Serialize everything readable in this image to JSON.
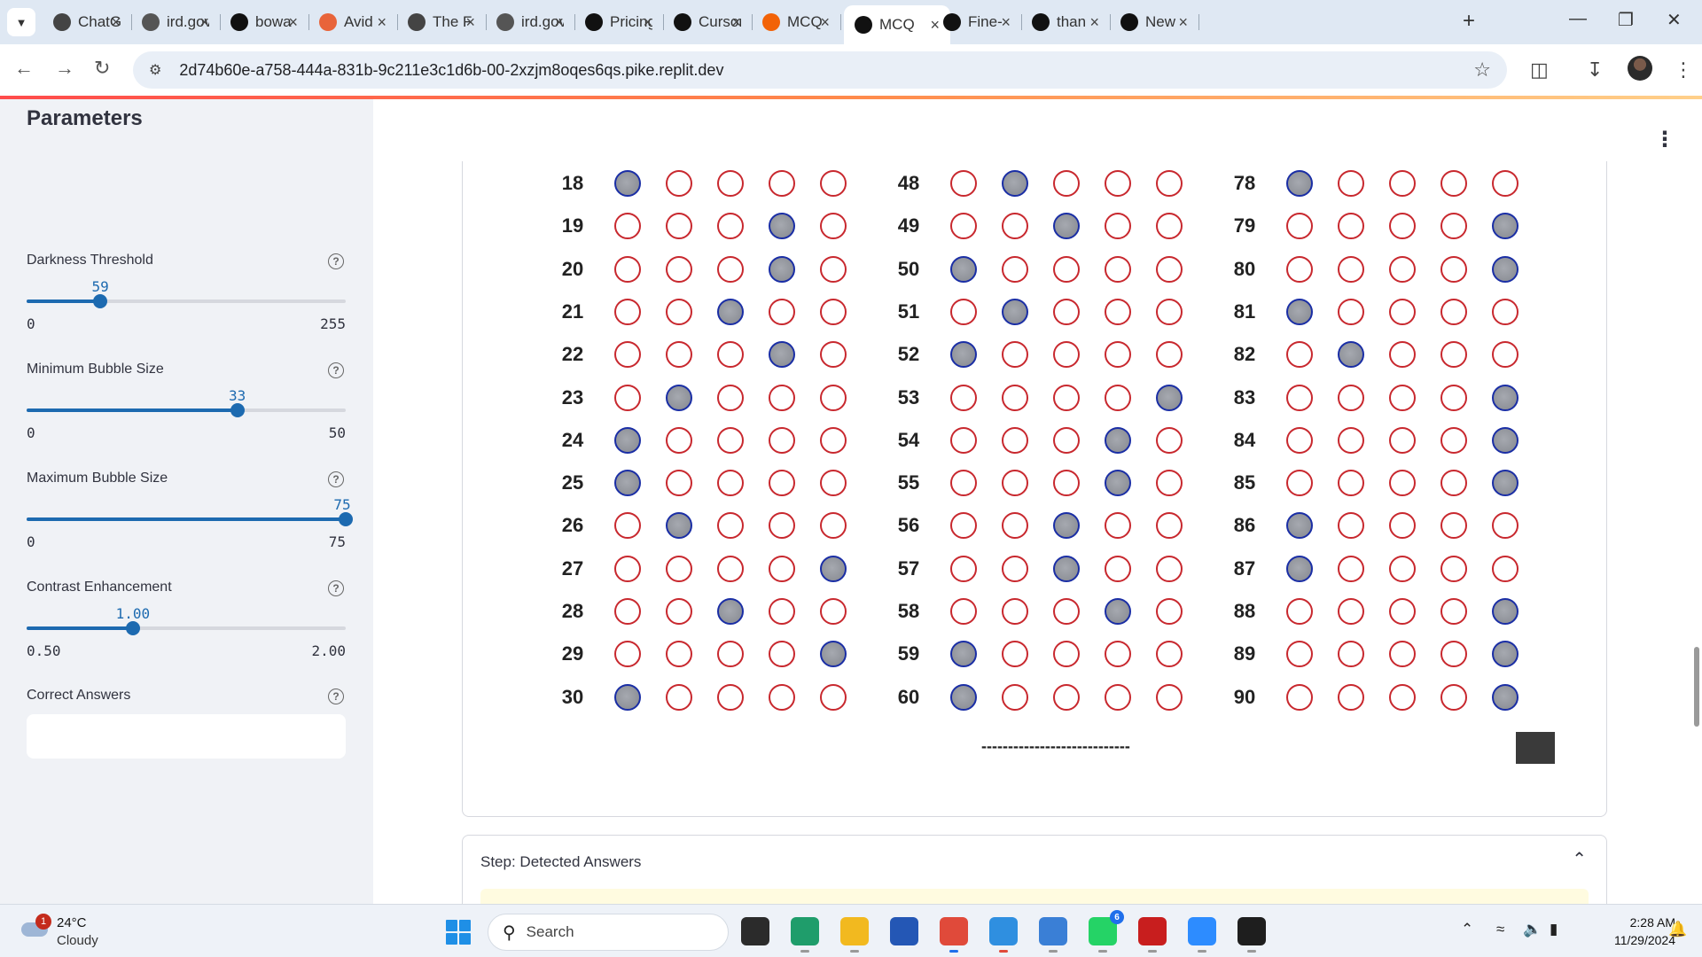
{
  "browser": {
    "tabs": [
      {
        "label": "ChatGPT",
        "icon": "chatgpt-icon",
        "color": "#444"
      },
      {
        "label": "ird.gov",
        "icon": "globe-icon",
        "color": "#555"
      },
      {
        "label": "bowa",
        "icon": "github-icon",
        "color": "#111"
      },
      {
        "label": "Avid",
        "icon": "avid-icon",
        "color": "#e8643a"
      },
      {
        "label": "The F",
        "icon": "chatgpt-icon",
        "color": "#444"
      },
      {
        "label": "ird.gov",
        "icon": "globe-icon",
        "color": "#555"
      },
      {
        "label": "Pricing",
        "icon": "cursor-icon",
        "color": "#111"
      },
      {
        "label": "Cursor",
        "icon": "cursor-icon",
        "color": "#111"
      },
      {
        "label": "MCQ",
        "icon": "replit-icon",
        "color": "#f26207"
      },
      {
        "label": "MCQ",
        "icon": "streamlit-icon",
        "color": "#111",
        "active": true
      },
      {
        "label": "Fine-",
        "icon": "github-icon",
        "color": "#111"
      },
      {
        "label": "than",
        "icon": "github-icon",
        "color": "#111"
      },
      {
        "label": "New",
        "icon": "lt-icon",
        "color": "#111"
      }
    ],
    "url": "2d74b60e-a758-444a-831b-9c211e3c1d6b-00-2xzjm8oqes6qs.pike.replit.dev"
  },
  "sidebar": {
    "title": "Parameters",
    "controls": [
      {
        "label": "Darkness Threshold",
        "value": "59",
        "min": "0",
        "max": "255",
        "fraction": 0.231
      },
      {
        "label": "Minimum Bubble Size",
        "value": "33",
        "min": "0",
        "max": "50",
        "fraction": 0.66
      },
      {
        "label": "Maximum Bubble Size",
        "value": "75",
        "min": "0",
        "max": "75",
        "fraction": 1.0
      },
      {
        "label": "Contrast Enhancement",
        "value": "1.00",
        "min": "0.50",
        "max": "2.00",
        "fraction": 0.333
      }
    ],
    "correct_answers_label": "Correct Answers",
    "correct_answers_value": ""
  },
  "sheet": {
    "columns": [
      {
        "rows": [
          {
            "n": "18",
            "filled": 1
          },
          {
            "n": "19",
            "filled": 4
          },
          {
            "n": "20",
            "filled": 4
          },
          {
            "n": "21",
            "filled": 3
          },
          {
            "n": "22",
            "filled": 4
          },
          {
            "n": "23",
            "filled": 2
          },
          {
            "n": "24",
            "filled": 1
          },
          {
            "n": "25",
            "filled": 1
          },
          {
            "n": "26",
            "filled": 2
          },
          {
            "n": "27",
            "filled": 5
          },
          {
            "n": "28",
            "filled": 3
          },
          {
            "n": "29",
            "filled": 5
          },
          {
            "n": "30",
            "filled": 1
          }
        ]
      },
      {
        "rows": [
          {
            "n": "48",
            "filled": 2
          },
          {
            "n": "49",
            "filled": 3
          },
          {
            "n": "50",
            "filled": 1
          },
          {
            "n": "51",
            "filled": 2
          },
          {
            "n": "52",
            "filled": 1
          },
          {
            "n": "53",
            "filled": 5
          },
          {
            "n": "54",
            "filled": 4
          },
          {
            "n": "55",
            "filled": 4
          },
          {
            "n": "56",
            "filled": 3
          },
          {
            "n": "57",
            "filled": 3
          },
          {
            "n": "58",
            "filled": 4
          },
          {
            "n": "59",
            "filled": 1
          },
          {
            "n": "60",
            "filled": 1
          }
        ]
      },
      {
        "rows": [
          {
            "n": "78",
            "filled": 1
          },
          {
            "n": "79",
            "filled": 5
          },
          {
            "n": "80",
            "filled": 5
          },
          {
            "n": "81",
            "filled": 1
          },
          {
            "n": "82",
            "filled": 2
          },
          {
            "n": "83",
            "filled": 5
          },
          {
            "n": "84",
            "filled": 5
          },
          {
            "n": "85",
            "filled": 5
          },
          {
            "n": "86",
            "filled": 1
          },
          {
            "n": "87",
            "filled": 1
          },
          {
            "n": "88",
            "filled": 5
          },
          {
            "n": "89",
            "filled": 5
          },
          {
            "n": "90",
            "filled": 5
          }
        ]
      }
    ],
    "footer_dashes": "----------------------------"
  },
  "expander": {
    "title": "Step: Detected Answers"
  },
  "taskbar": {
    "temperature": "24°C",
    "condition": "Cloudy",
    "weather_badge": "1",
    "search_label": "Search",
    "whatsapp_badge": "6",
    "time": "2:28 AM",
    "date": "11/29/2024"
  }
}
